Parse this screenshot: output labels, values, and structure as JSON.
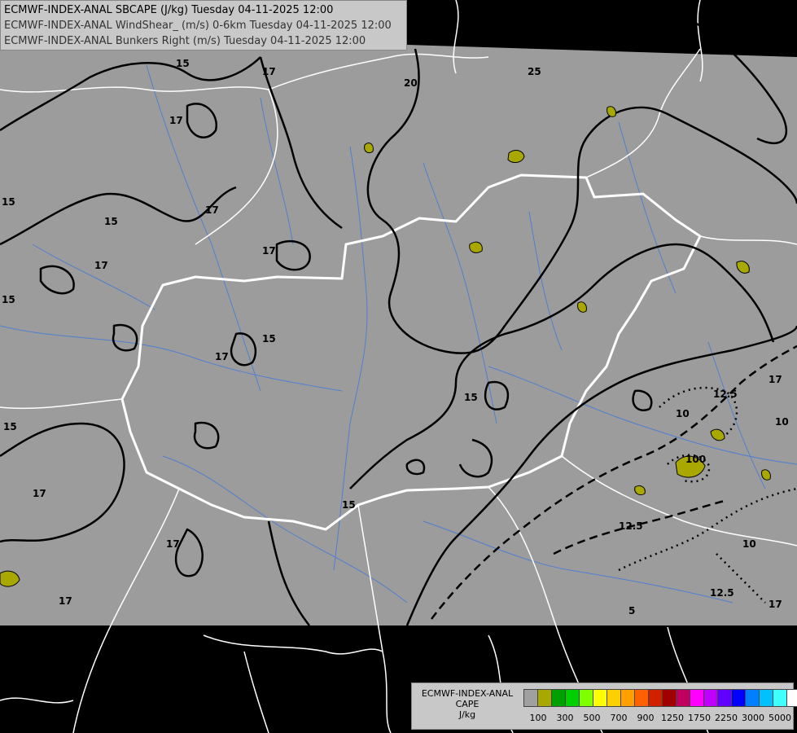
{
  "header": {
    "line1": "ECMWF-INDEX-ANAL SBCAPE (J/kg) Tuesday 04-11-2025 12:00",
    "line2": "ECMWF-INDEX-ANAL WindShear_ (m/s) 0-6km Tuesday 04-11-2025 12:00",
    "line3": "ECMWF-INDEX-ANAL Bunkers Right (m/s) Tuesday 04-11-2025 12:00"
  },
  "legend": {
    "title_line1": "ECMWF-INDEX-ANAL",
    "title_line2": "CAPE",
    "title_line3": "J/kg",
    "colors": [
      "#a0a0a0",
      "#a8a800",
      "#00a000",
      "#00d000",
      "#80ff00",
      "#ffff00",
      "#ffd000",
      "#ffa000",
      "#ff6000",
      "#d02000",
      "#a00000",
      "#c00060",
      "#ff00ff",
      "#c000ff",
      "#6000ff",
      "#0000ff",
      "#0080ff",
      "#00c0ff",
      "#40ffff",
      "#ffffff"
    ],
    "ticks": [
      "100",
      "300",
      "500",
      "700",
      "900",
      "1250",
      "1750",
      "2250",
      "3000",
      "5000"
    ]
  },
  "contour_labels": {
    "l15": "15",
    "l17": "17",
    "l20": "20",
    "l25": "25",
    "l10": "10",
    "l125": "12.5",
    "l100": "100",
    "l5": "5"
  },
  "colors": {
    "data_area": "#9c9c9c",
    "no_data": "#000000",
    "borders": "#ffffff",
    "rivers": "#4f7fd0",
    "contours": "#000000",
    "cape_low": "#a8a800"
  }
}
